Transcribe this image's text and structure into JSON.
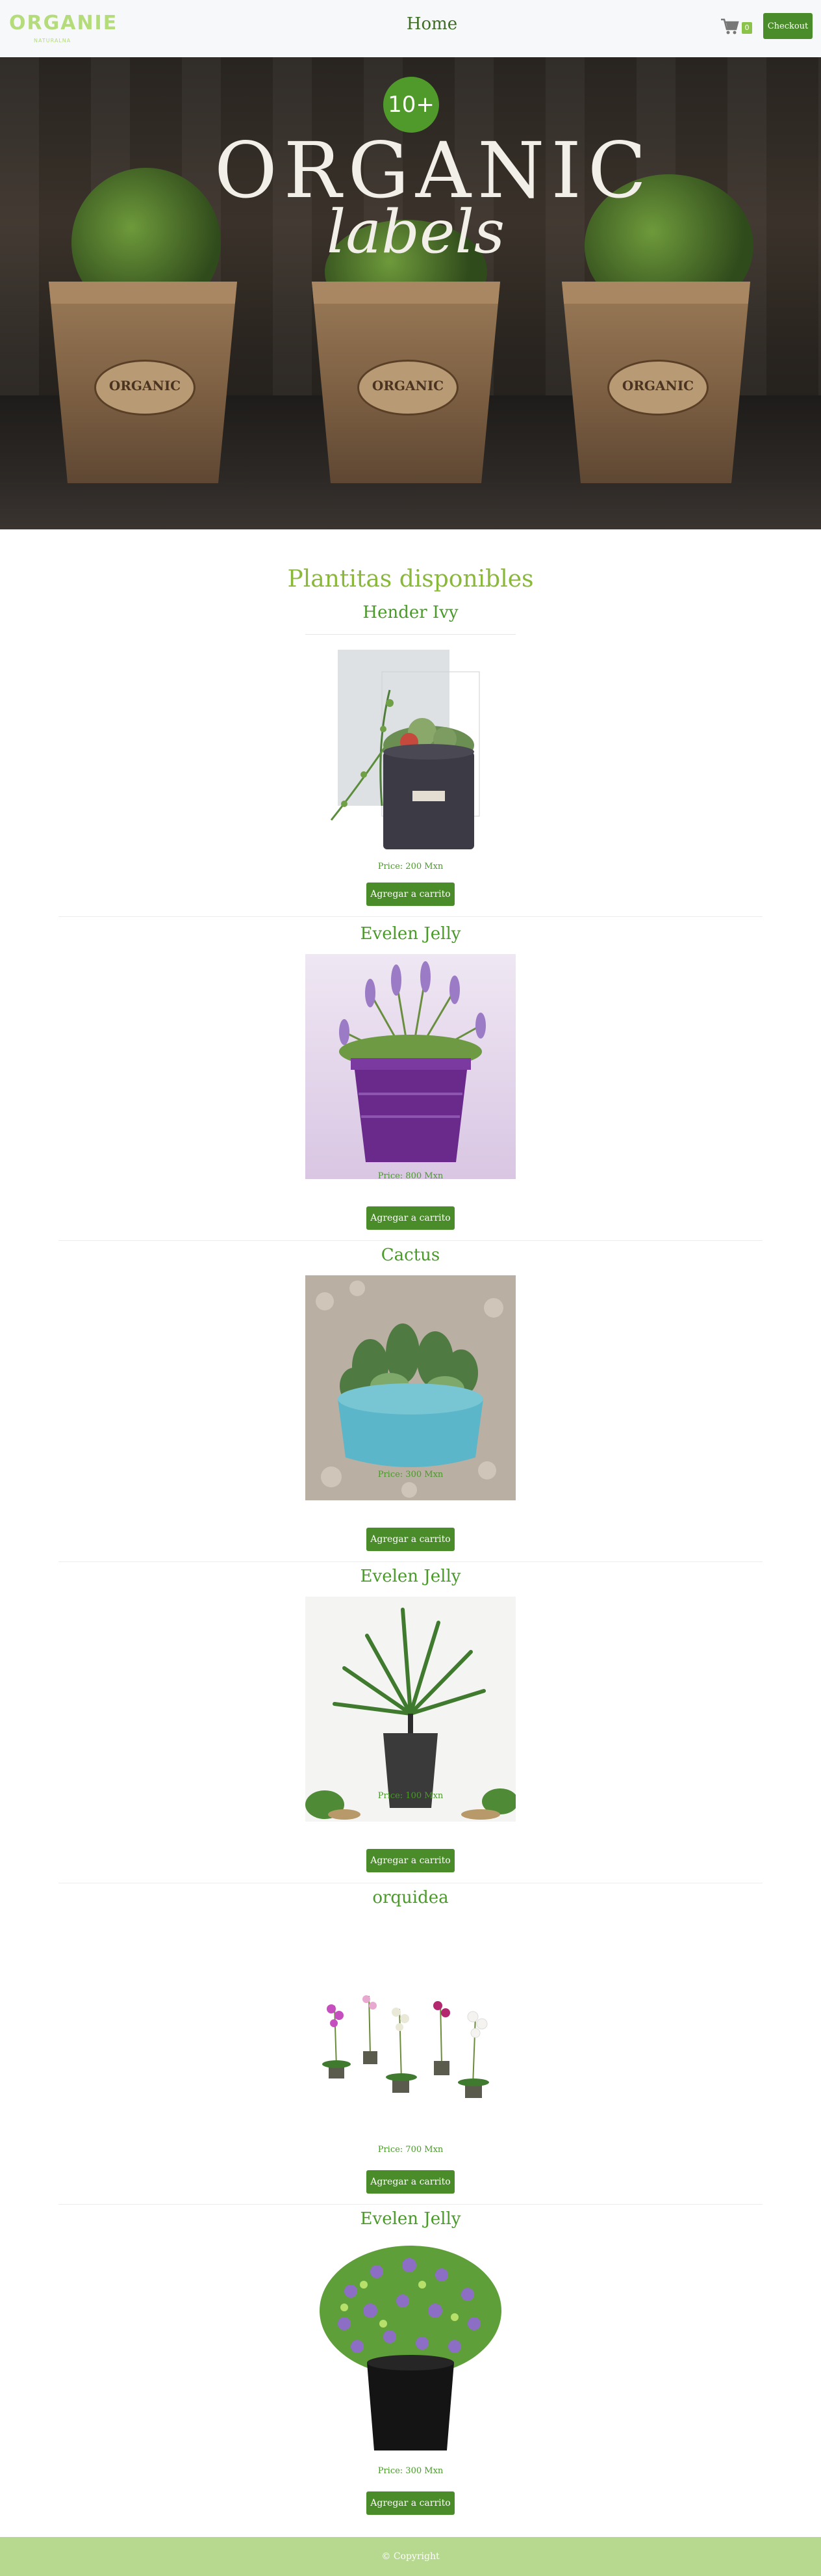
{
  "header": {
    "logo_text": "ORGANIE",
    "logo_subtext": "NATURALNA",
    "nav_home": "Home",
    "cart_count": "0",
    "checkout_label": "Checkout"
  },
  "hero": {
    "badge": "10+",
    "title": "ORGANIC",
    "subtitle": "labels",
    "pot_labels": [
      "ORGANIC",
      "ORGANIC",
      "ORGANIC"
    ]
  },
  "section_title": "Plantitas disponibles",
  "products": [
    {
      "name": "Hender Ivy",
      "price": "Price: 200 Mxn",
      "button": "Agregar a carrito"
    },
    {
      "name": "Evelen Jelly",
      "price": "Price: 800 Mxn",
      "button": "Agregar a carrito"
    },
    {
      "name": "Cactus",
      "price": "Price: 300 Mxn",
      "button": "Agregar a carrito"
    },
    {
      "name": "Evelen Jelly",
      "price": "Price: 100 Mxn",
      "button": "Agregar a carrito"
    },
    {
      "name": "orquidea",
      "price": "Price: 700 Mxn",
      "button": "Agregar a carrito"
    },
    {
      "name": "Evelen Jelly",
      "price": "Price: 300 Mxn",
      "button": "Agregar a carrito"
    }
  ],
  "footer": {
    "text": "© Copyright"
  },
  "colors": {
    "accent": "#4a8c29",
    "logo": "#b5dc7a",
    "footer": "#b6d88f",
    "product_title": "#4a9a2a"
  }
}
